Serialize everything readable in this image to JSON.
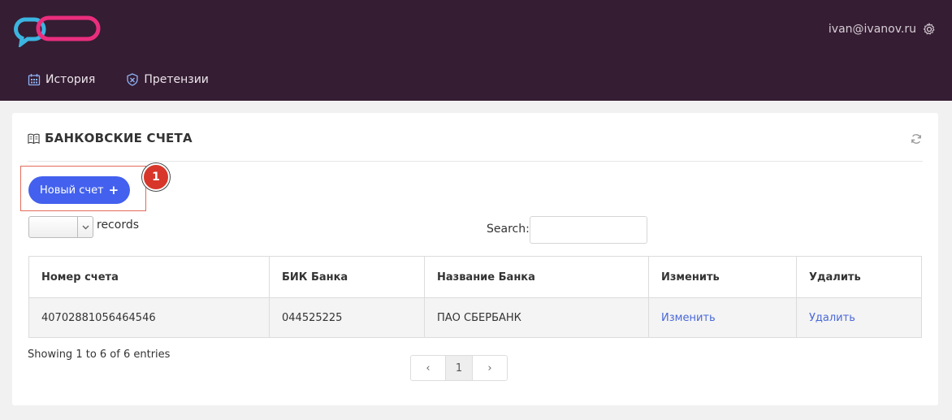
{
  "header": {
    "user_email": "ivan@ivanov.ru",
    "colors": {
      "background": "#351d33",
      "logo_blue": "#3cb4e0",
      "logo_pink": "#ea2e7e"
    }
  },
  "nav": {
    "items": [
      {
        "label": "История",
        "icon": "calendar-icon"
      },
      {
        "label": "Претензии",
        "icon": "shield-icon"
      }
    ]
  },
  "card": {
    "title": "БАНКОВСКИЕ СЧЕТА",
    "new_button_label": "Новый счет",
    "annotation_badge": "1",
    "records_label": "records",
    "search_label": "Search:",
    "search_value": "",
    "page_length_value": ""
  },
  "table": {
    "headers": [
      "Номер счета",
      "БИК Банка",
      "Название Банка",
      "Изменить",
      "Удалить"
    ],
    "rows": [
      [
        "40702881056464546",
        "044525225",
        "ПАО СБЕРБАНК",
        "Изменить",
        "Удалить"
      ]
    ]
  },
  "footer": {
    "info": "Showing 1 to 6 of 6 entries",
    "pager": {
      "prev": "‹",
      "current": "1",
      "next": "›"
    }
  },
  "accent_color": "#4361ee"
}
